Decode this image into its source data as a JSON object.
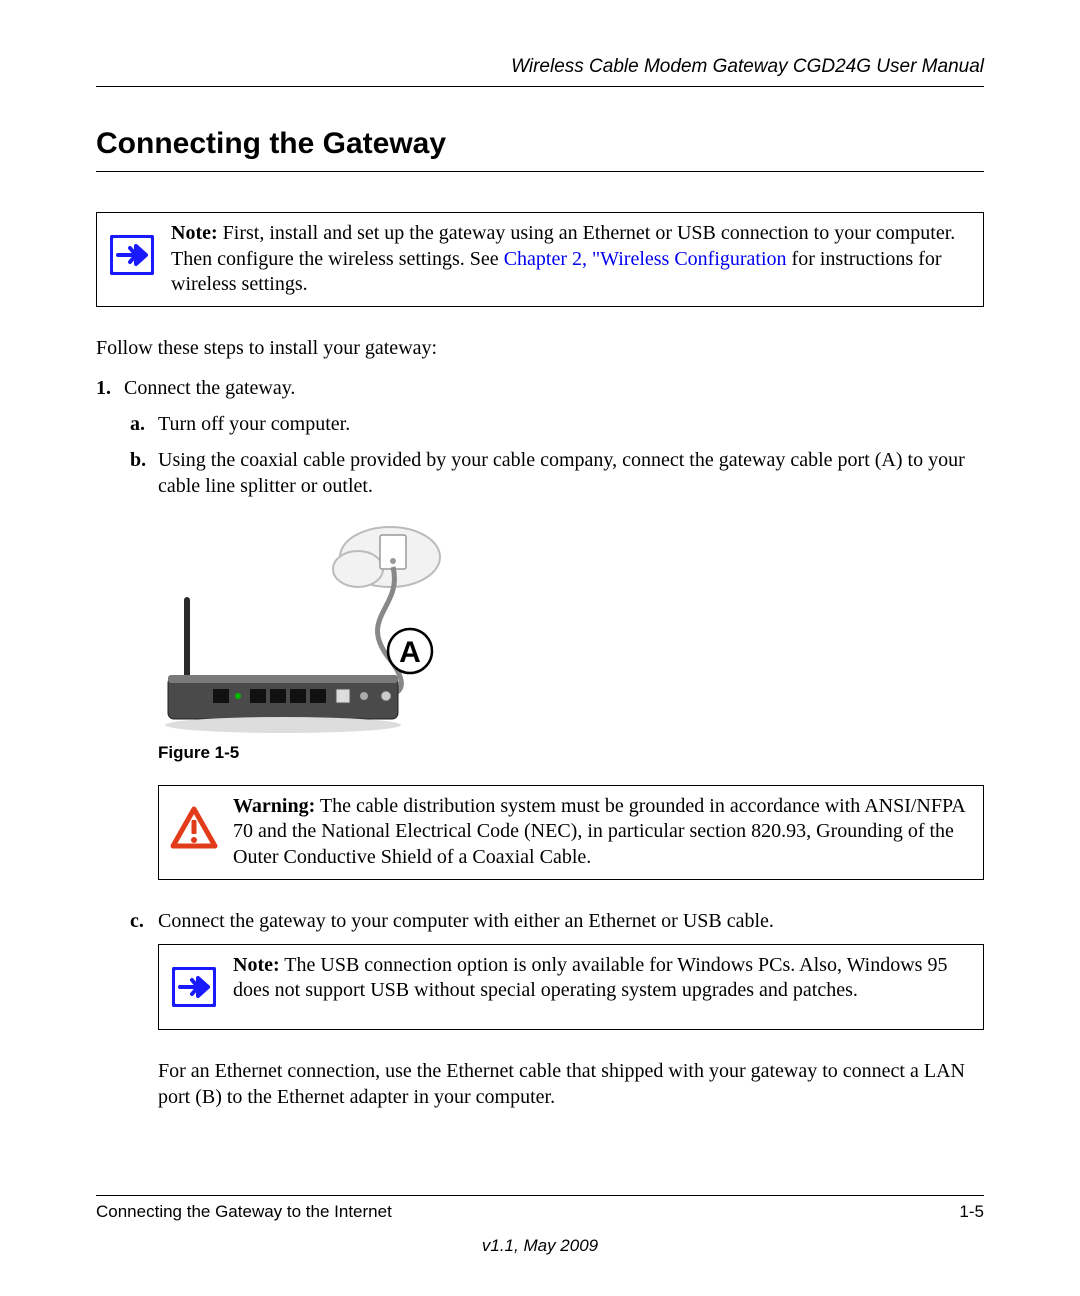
{
  "header": {
    "title": "Wireless Cable Modem Gateway CGD24G User Manual"
  },
  "section": {
    "title": "Connecting the Gateway"
  },
  "note1": {
    "label": "Note:",
    "text_part1": " First, install and set up the gateway using an Ethernet or USB connection to your computer. Then configure the wireless settings. See ",
    "link_text": "Chapter 2, \"Wireless Configuration",
    "text_part2": " for instructions for wireless settings."
  },
  "intro": "Follow these steps to install your gateway:",
  "step1": {
    "num": "1.",
    "text": "Connect the gateway."
  },
  "sub_a": {
    "letter": "a.",
    "text": "Turn off your computer."
  },
  "sub_b": {
    "letter": "b.",
    "text": "Using the coaxial cable provided by your cable company, connect the gateway cable port (A) to your cable line splitter or outlet."
  },
  "figure": {
    "caption": "Figure 1-5",
    "label_a": "A"
  },
  "warning": {
    "label": "Warning:",
    "text": " The cable distribution system must be grounded in accordance with ANSI/NFPA 70 and the National Electrical Code (NEC), in particular section 820.93, Grounding of the Outer Conductive Shield of a Coaxial Cable."
  },
  "sub_c": {
    "letter": "c.",
    "text": "Connect the gateway to your computer with either an Ethernet or USB cable."
  },
  "note2": {
    "label": "Note:",
    "text": " The USB connection option is only available for Windows PCs. Also, Windows 95 does not support USB without special operating system upgrades and patches."
  },
  "para_after": "For an Ethernet connection, use the Ethernet cable that shipped with your gateway to connect a LAN port (B) to the Ethernet adapter in your computer.",
  "footer": {
    "left": "Connecting the Gateway to the Internet",
    "right": "1-5",
    "version": "v1.1, May 2009"
  }
}
